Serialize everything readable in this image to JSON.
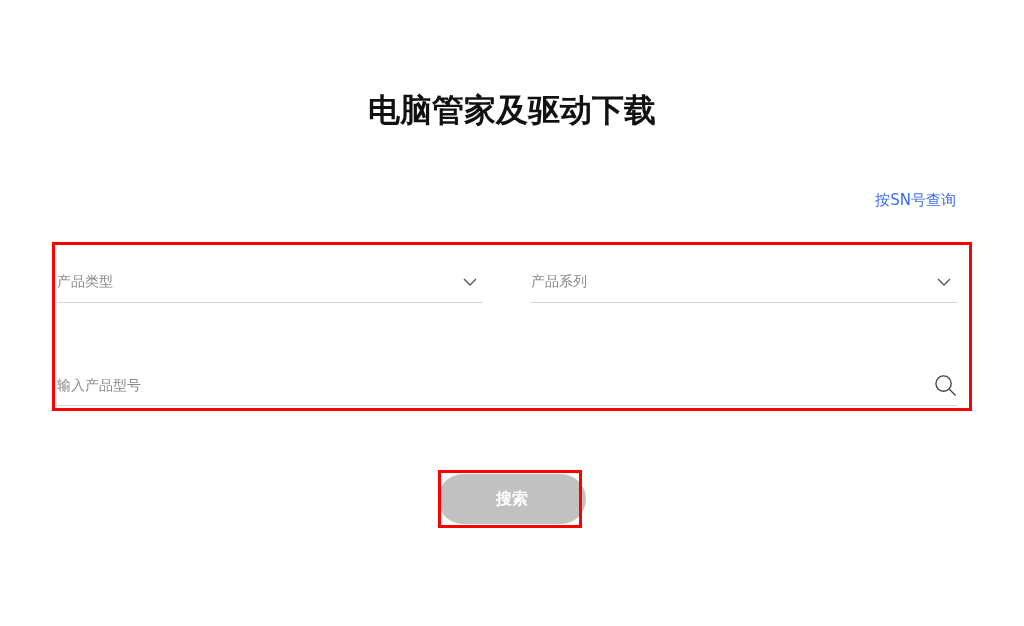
{
  "title": "电脑管家及驱动下载",
  "sn_link": "按SN号查询",
  "form": {
    "highlighted": true,
    "selects": [
      {
        "placeholder": "产品类型"
      },
      {
        "placeholder": "产品系列"
      }
    ],
    "model_input": {
      "placeholder": "输入产品型号"
    }
  },
  "search_button": {
    "label": "搜索",
    "disabled": true,
    "highlighted": true
  }
}
